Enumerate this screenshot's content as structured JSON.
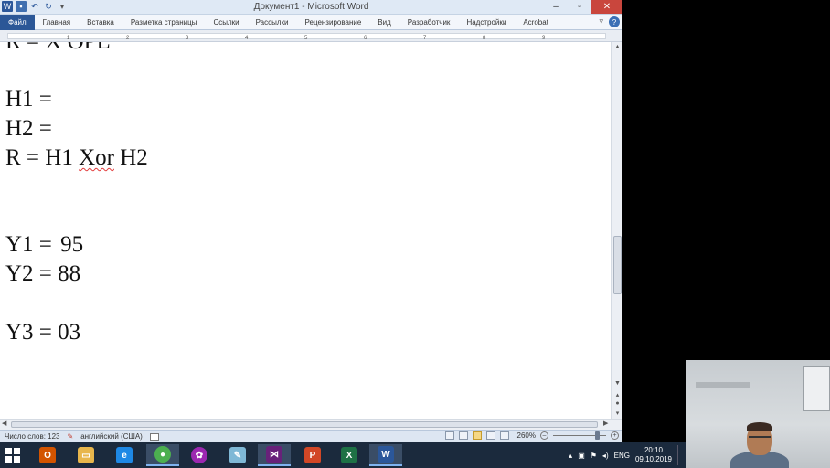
{
  "window": {
    "title": "Документ1 - Microsoft Word",
    "controls": {
      "minimize": "–",
      "maximize": "▫",
      "close": "✕"
    }
  },
  "ribbon": {
    "tabs": [
      {
        "label": "Файл"
      },
      {
        "label": "Главная"
      },
      {
        "label": "Вставка"
      },
      {
        "label": "Разметка страницы"
      },
      {
        "label": "Ссылки"
      },
      {
        "label": "Рассылки"
      },
      {
        "label": "Рецензирование"
      },
      {
        "label": "Вид"
      },
      {
        "label": "Разработчик"
      },
      {
        "label": "Надстройки"
      },
      {
        "label": "Acrobat"
      }
    ],
    "help": "?"
  },
  "ruler": {
    "numbers": [
      "1",
      "2",
      "3",
      "4",
      "5",
      "6",
      "7",
      "8",
      "9"
    ]
  },
  "document": {
    "lines": {
      "partial": "R = X OPL",
      "h1": "H1 =",
      "h2": "H2 =",
      "r_prefix": "R = H1 ",
      "r_xor": "Xor",
      "r_suffix": " H2",
      "y1_prefix": "Y1 = ",
      "y1_value": "95",
      "y2": "Y2 = 88",
      "y3": "Y3 = 03"
    }
  },
  "statusbar": {
    "word_count": "Число слов: 123",
    "language": "английский (США)",
    "zoom": "260%",
    "zoom_level_fraction": 0.87
  },
  "taskbar": {
    "apps": [
      {
        "icon": "outlook-icon",
        "color": "#d35400"
      },
      {
        "icon": "file-explorer-icon",
        "color": "#e8b64c"
      },
      {
        "icon": "internet-explorer-icon",
        "color": "#1e88e5"
      },
      {
        "icon": "chrome-icon",
        "color": "#4caf50"
      },
      {
        "icon": "picasa-icon",
        "color": "#9c27b0"
      },
      {
        "icon": "notepad-icon",
        "color": "#7fb8d6"
      },
      {
        "icon": "visual-studio-icon",
        "color": "#68217a"
      },
      {
        "icon": "powerpoint-icon",
        "color": "#d24726"
      },
      {
        "icon": "excel-icon",
        "color": "#1e7145"
      },
      {
        "icon": "word-icon",
        "color": "#2b579a"
      }
    ],
    "tray": {
      "language": "ENG",
      "time": "20:10",
      "date": "09.10.2019"
    }
  },
  "colors": {
    "accent": "#2b5797",
    "spellcheck": "#e23b3b"
  }
}
